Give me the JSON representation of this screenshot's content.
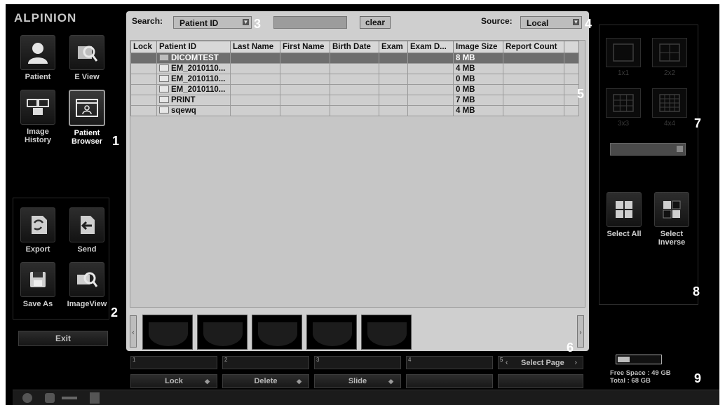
{
  "app": {
    "logo": "ALPINION"
  },
  "left_nav": {
    "items": [
      {
        "label": "Patient",
        "icon": "patient-icon"
      },
      {
        "label": "E View",
        "icon": "eview-icon"
      },
      {
        "label1": "Image",
        "label2": "History",
        "icon": "image-history-icon"
      },
      {
        "label1": "Patient",
        "label2": "Browser",
        "icon": "patient-browser-icon",
        "selected": true
      }
    ],
    "actions": [
      {
        "label": "Export",
        "icon": "export-icon"
      },
      {
        "label": "Send",
        "icon": "send-icon"
      },
      {
        "label": "Save As",
        "icon": "save-icon"
      },
      {
        "label": "ImageView",
        "icon": "imageview-icon"
      }
    ],
    "exit_label": "Exit"
  },
  "search": {
    "label": "Search:",
    "field": "Patient ID",
    "query": "",
    "clear_label": "clear",
    "source_label": "Source:",
    "source": "Local"
  },
  "table": {
    "columns": [
      "Lock",
      "Patient ID",
      "Last Name",
      "First Name",
      "Birth Date",
      "Exam",
      "Exam D...",
      "Image Size",
      "Report Count",
      ""
    ],
    "rows": [
      {
        "lock": "",
        "patient_id": "DICOMTEST",
        "last_name": "",
        "first_name": "",
        "birth_date": "",
        "exam": "",
        "exam_date": "",
        "image_size": "8 MB",
        "report_count": "",
        "selected": true
      },
      {
        "lock": "",
        "patient_id": "EM_2010110...",
        "last_name": "",
        "first_name": "",
        "birth_date": "",
        "exam": "",
        "exam_date": "",
        "image_size": "4 MB",
        "report_count": ""
      },
      {
        "lock": "",
        "patient_id": "EM_2010110...",
        "last_name": "",
        "first_name": "",
        "birth_date": "",
        "exam": "",
        "exam_date": "",
        "image_size": "0 MB",
        "report_count": ""
      },
      {
        "lock": "",
        "patient_id": "EM_2010110...",
        "last_name": "",
        "first_name": "",
        "birth_date": "",
        "exam": "",
        "exam_date": "",
        "image_size": "0 MB",
        "report_count": ""
      },
      {
        "lock": "",
        "patient_id": "PRINT",
        "last_name": "",
        "first_name": "",
        "birth_date": "",
        "exam": "",
        "exam_date": "",
        "image_size": "7 MB",
        "report_count": ""
      },
      {
        "lock": "",
        "patient_id": "sqewq",
        "last_name": "",
        "first_name": "",
        "birth_date": "",
        "exam": "",
        "exam_date": "",
        "image_size": "4 MB",
        "report_count": ""
      }
    ]
  },
  "thumbnails": {
    "count": 5,
    "prev": "‹",
    "next": "›"
  },
  "bottom": {
    "slots": [
      "1",
      "2",
      "3",
      "4",
      "5"
    ],
    "select_page_label": "Select Page",
    "select_page_arrow_left": "‹",
    "select_page_arrow_right": "›",
    "buttons": [
      {
        "label": "Lock"
      },
      {
        "label": "Delete"
      },
      {
        "label": "Slide"
      }
    ]
  },
  "right_panel": {
    "layouts": [
      {
        "label": "1x1",
        "divisions": 1
      },
      {
        "label": "2x2",
        "divisions": 2
      },
      {
        "label": "3x3",
        "divisions": 3
      },
      {
        "label": "4x4",
        "divisions": 4
      }
    ],
    "select_all_label": "Select All",
    "select_inverse_label1": "Select",
    "select_inverse_label2": "Inverse"
  },
  "storage": {
    "used_fraction": 0.28,
    "free_space": "Free Space : 49 GB",
    "total": "Total : 68 GB"
  },
  "callouts": [
    "1",
    "2",
    "3",
    "4",
    "5",
    "6",
    "7",
    "8",
    "9"
  ],
  "colors": {
    "background": "#000000",
    "window": "#cfcfcf",
    "selected_row": "#6e6e6e"
  }
}
